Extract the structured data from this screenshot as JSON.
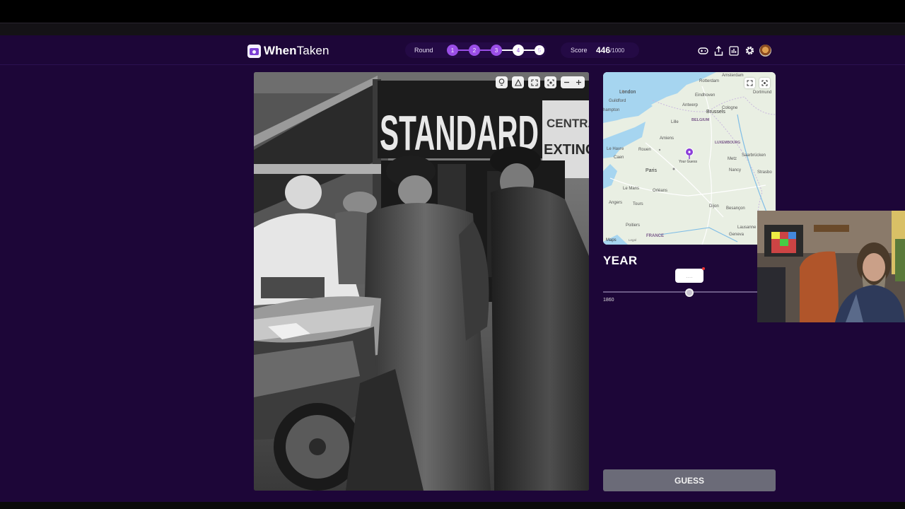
{
  "app": {
    "name_part1": "When",
    "name_part2": "Taken"
  },
  "round": {
    "label": "Round",
    "steps": [
      "1",
      "2",
      "3",
      "4",
      "5"
    ],
    "current": "4"
  },
  "score": {
    "label": "Score",
    "value": "446",
    "max": "/1000"
  },
  "header_icons": [
    "gamepad-icon",
    "share-icon",
    "stats-icon",
    "gear-icon",
    "avatar"
  ],
  "photo": {
    "banner_text": "STANDARD",
    "sign_text_1": "CENTRA",
    "sign_text_2": "EXTINCTE"
  },
  "map": {
    "labels": {
      "amsterdam": "Amsterdam",
      "rotterdam": "Rotterdam",
      "london": "London",
      "guildford": "Guildford",
      "hampton": "hampton",
      "eindhoven": "Eindhoven",
      "dortmund": "Dortmund",
      "antwerp": "Antwerp",
      "brussels": "Brussels",
      "cologne": "Cologne",
      "lille": "Lille",
      "belgium": "BELGIUM",
      "amiens": "Amiens",
      "luxembourg": "LUXEMBOURG",
      "le_havre": "Le Havre",
      "rouen": "Rouen",
      "caen": "Caen",
      "paris": "Paris",
      "saarbrucken": "Saarbrücken",
      "metz": "Metz",
      "nancy": "Nancy",
      "strasbourg": "Strasbo",
      "your_guess": "Your Guess",
      "le_mans": "Le Mans",
      "orleans": "Orléans",
      "angers": "Angers",
      "tours": "Tours",
      "dijon": "Dijon",
      "besancon": "Besançon",
      "poitiers": "Poitiers",
      "lausanne": "Lausanne",
      "geneva": "Geneva",
      "france": "FRANCE",
      "maps_credit": "Maps",
      "legal": "Legal"
    },
    "colors": {
      "land": "#e9efe3",
      "water": "#a6d5f0",
      "pin": "#8b3fd9"
    }
  },
  "year": {
    "title": "YEAR",
    "bubble_value": "....",
    "min_label": "1860",
    "slider_fraction": 0.5
  },
  "guess": {
    "label": "GUESS"
  }
}
